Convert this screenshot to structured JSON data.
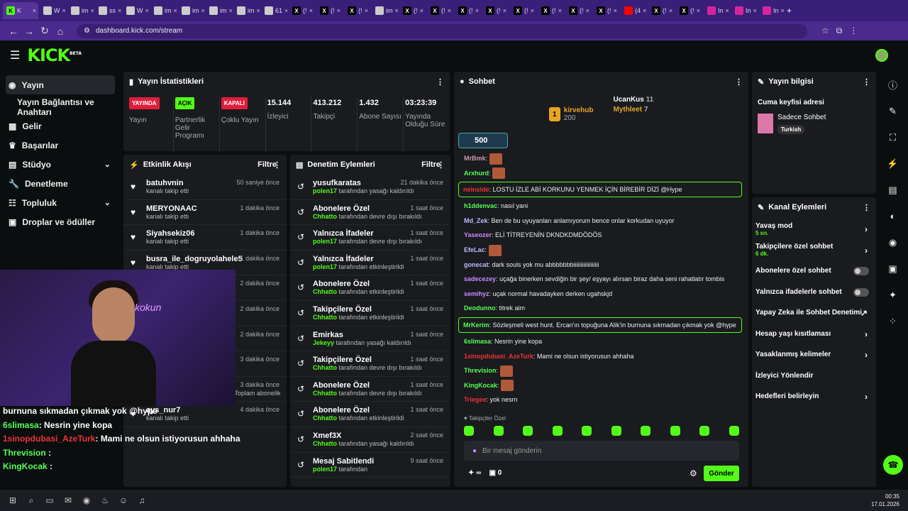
{
  "browser": {
    "url": "dashboard.kick.com/stream",
    "tabs": [
      "K",
      "W",
      "im",
      "ss",
      "W",
      "im",
      "im",
      "im",
      "im",
      "61",
      "(!",
      "(!",
      "(!",
      "im",
      "(!",
      "(!",
      "(!",
      "(!",
      "(!",
      "(!",
      "(!",
      "(!",
      "(4",
      "(!",
      "(!",
      "In",
      "In",
      "In"
    ],
    "new_tab": "+"
  },
  "brand": {
    "logo": "KICK",
    "beta": "BETA",
    "accent": "#53fc18"
  },
  "sidebar": {
    "items": [
      {
        "label": "Yayın",
        "icon": "broadcast-icon"
      },
      {
        "label": "Yayın Bağlantısı ve Anahtarı",
        "icon": ""
      },
      {
        "label": "Gelir",
        "icon": "revenue-icon"
      },
      {
        "label": "Başarılar",
        "icon": "trophy-icon"
      },
      {
        "label": "Stüdyo",
        "icon": "studio-icon"
      },
      {
        "label": "Denetleme",
        "icon": "wrench-icon"
      },
      {
        "label": "Topluluk",
        "icon": "community-icon"
      },
      {
        "label": "Droplar ve ödüller",
        "icon": "gift-icon"
      }
    ]
  },
  "stats": {
    "title": "Yayın İstatistikleri",
    "items": [
      {
        "badge": "YAYINDA",
        "label": "Yayın"
      },
      {
        "badge": "AÇIK",
        "label": "Partnerlik Gelir Programı"
      },
      {
        "badge": "KAPALI",
        "label": "Çoklu Yayın"
      },
      {
        "value": "15.144",
        "label": "İzleyici"
      },
      {
        "value": "413.212",
        "label": "Takipçi"
      },
      {
        "value": "1.432",
        "label": "Abone Sayısı"
      },
      {
        "value": "03:23:39",
        "label": "Yayında Olduğu Süre"
      }
    ]
  },
  "activity": {
    "title": "Etkinlik Akışı",
    "filter": "Filtre",
    "rows": [
      {
        "name": "batuhvnin",
        "sub": "kanalı takip etti",
        "time": "50 saniye önce"
      },
      {
        "name": "MERYONAAC",
        "sub": "kanalı takip etti",
        "time": "1 dakika önce"
      },
      {
        "name": "Siyahsekiz06",
        "sub": "kanalı takip etti",
        "time": "1 dakika önce"
      },
      {
        "name": "busra_ile_dogruyolahele5",
        "sub": "kanalı takip etti",
        "time": "1 dakika önce"
      },
      {
        "name": "",
        "sub": "",
        "time": "2 dakika önce"
      },
      {
        "name": "",
        "sub": "",
        "time": "2 dakika önce"
      },
      {
        "name": "",
        "sub": "plam abonelik",
        "time": "2 dakika önce"
      },
      {
        "name": "",
        "sub": "",
        "time": "3 dakika önce"
      },
      {
        "name": "yyuck_01",
        "sub": "abonelik yenilemesini kutluyor! Toplam abonelik süresi - 24 ay!",
        "time": "3 dakika önce"
      },
      {
        "name": "ays_nur7",
        "sub": "kanalı takip etti",
        "time": "4 dakika önce"
      }
    ]
  },
  "moderation": {
    "title": "Denetim Eylemleri",
    "filter": "Filtre",
    "rows": [
      {
        "name": "yusufkaratas",
        "user": "polen17",
        "sub": "tarafından yasağı kaldırıldı",
        "time": "21 dakika önce"
      },
      {
        "name": "Abonelere Özel",
        "user": "Chhatto",
        "sub": "tarafından devre dışı bırakıldı",
        "time": "1 saat önce"
      },
      {
        "name": "Yalnızca İfadeler",
        "user": "polen17",
        "sub": "tarafından devre dışı bırakıldı",
        "time": "1 saat önce"
      },
      {
        "name": "Yalnızca İfadeler",
        "user": "polen17",
        "sub": "tarafından etkinleştirildi",
        "time": "1 saat önce"
      },
      {
        "name": "Abonelere Özel",
        "user": "Chhatto",
        "sub": "tarafından etkinleştirildi",
        "time": "1 saat önce"
      },
      {
        "name": "Takipçilere Özel",
        "user": "Chhatto",
        "sub": "tarafından etkinleştirildi",
        "time": "1 saat önce"
      },
      {
        "name": "Emirkas",
        "user": "Jekeyy",
        "sub": "tarafından yasağı kaldırıldı",
        "time": "1 saat önce"
      },
      {
        "name": "Takipçilere Özel",
        "user": "Chhatto",
        "sub": "tarafından devre dışı bırakıldı",
        "time": "1 saat önce"
      },
      {
        "name": "Abonelere Özel",
        "user": "Chhatto",
        "sub": "tarafından devre dışı bırakıldı",
        "time": "1 saat önce"
      },
      {
        "name": "Abonelere Özel",
        "user": "Chhatto",
        "sub": "tarafından etkinleştirildi",
        "time": "1 saat önce"
      },
      {
        "name": "Xmef3X",
        "user": "Chhatto",
        "sub": "tarafından yasağı kaldırıldı",
        "time": "2 saat önce"
      },
      {
        "name": "Mesaj Sabitlendi",
        "user": "polen17",
        "sub": "tarafından",
        "time": "9 saat önce"
      }
    ]
  },
  "chat": {
    "title": "Sohbet",
    "leader": {
      "rank": "1",
      "name": "kirvehub",
      "score": "200",
      "second": "UcanKus",
      "second_score": "11",
      "third": "Mythleet",
      "third_score": "7"
    },
    "pinned": "500",
    "messages": [
      {
        "u": "MrBmk",
        "c": "#c9a",
        "t": "",
        "emote": true
      },
      {
        "u": "Arxhurd",
        "c": "#5f5",
        "t": "",
        "emote": true
      },
      {
        "u": "neinside",
        "c": "#e33",
        "t": "LOSTU İZLE ABİ KORKUNU YENMEK İÇİN BİREBİR DİZİ @Hype",
        "hl": true
      },
      {
        "u": "h1ddenvac",
        "c": "#5f5",
        "t": "nasıl yani"
      },
      {
        "u": "Md_Zek",
        "c": "#bbf",
        "t": "Ben de bu uyuyanları anlamıyorum bence onlar korkudan uyuyor"
      },
      {
        "u": "Yaseozer",
        "c": "#c8f",
        "t": "ELİ TİTREYENİN DKNDKDMDÖDÖS"
      },
      {
        "u": "EfeLac",
        "c": "#bbf",
        "t": "",
        "emote": true
      },
      {
        "u": "gonecat",
        "c": "#bbf",
        "t": "dark souls yok mu abbbbbbbiiiiiiiiiiiiiiiiii"
      },
      {
        "u": "sadecezey",
        "c": "#c8f",
        "t": "uçağa binerken sevdiğin bir şey/ eşyayı alırsan biraz daha seni rahatlatır tombis"
      },
      {
        "u": "semihyz",
        "c": "#c8f",
        "t": "uçak normal havadayken derken ugahskjd"
      },
      {
        "u": "Deodunno",
        "c": "#5f5",
        "t": "titrek aim"
      },
      {
        "u": "MrKerim",
        "c": "#5f5",
        "t": "Sözleşmeli west hunt. Ercan'ın topuğuna Alik'in burnuna sıkmadan çıkmak yok @hype",
        "hl": true
      },
      {
        "u": "6slimasa",
        "c": "#5f5",
        "t": "Nesrin yine kopa"
      },
      {
        "u": "1sinopdubasi_AzeTurk",
        "c": "#e33",
        "t": "Mami ne olsun istiyorusun ahhaha"
      },
      {
        "u": "Threvision",
        "c": "#5f5",
        "t": "",
        "emote": true
      },
      {
        "u": "KingKocak",
        "c": "#5f5",
        "t": "",
        "emote": true
      },
      {
        "u": "Triegee",
        "c": "#e33",
        "t": "yok nesrn"
      }
    ],
    "liked": "Takipçiler Özel",
    "input_placeholder": "Bir mesaj gönderin",
    "points": "∞",
    "count": "0",
    "send": "Gönder"
  },
  "info": {
    "title": "Yayın bilgisi",
    "stream_title": "Cuma keyfisi adresi",
    "category": "Sadece Sohbet",
    "tag": "Turkish"
  },
  "actions": {
    "title": "Kanal Eylemleri",
    "items": [
      {
        "label": "Yavaş mod",
        "sub": "5 sn.",
        "type": "arrow"
      },
      {
        "label": "Takipçilere özel sohbet",
        "sub": "6 dk.",
        "type": "arrow"
      },
      {
        "label": "Abonelere özel sohbet",
        "sub": "",
        "type": "toggle"
      },
      {
        "label": "Yalnızca ifadelerle sohbet",
        "sub": "",
        "type": "toggle"
      },
      {
        "label": "Yapay Zeka ile Sohbet Denetimi",
        "sub": "",
        "type": "ext"
      },
      {
        "label": "Hesap yaşı kısıtlaması",
        "sub": "",
        "type": "arrow"
      },
      {
        "label": "Yasaklanmış kelimeler",
        "sub": "",
        "type": "arrow"
      },
      {
        "label": "İzleyici Yönlendir",
        "sub": "",
        "type": "none"
      },
      {
        "label": "Hedefleri belirleyin",
        "sub": "",
        "type": "arrow"
      }
    ]
  },
  "overlay": {
    "lines": [
      {
        "u": "",
        "t": "burnuna sıkmadan çıkmak yok @hype"
      },
      {
        "u": "6slimasa",
        "t": ": Nesrin yine kopa",
        "c": "#5f5"
      },
      {
        "u": "1sinopdubasi_AzeTurk",
        "t": ": Mami ne olsun istiyorusun ahhaha",
        "c": "#e33"
      },
      {
        "u": "Threvision",
        "t": " :",
        "c": "#5f5"
      },
      {
        "u": "KingKocak",
        "t": " :",
        "c": "#5f5"
      }
    ],
    "neon": "kokun"
  },
  "clock": {
    "time": "00:35",
    "date": "17.01.2026"
  }
}
